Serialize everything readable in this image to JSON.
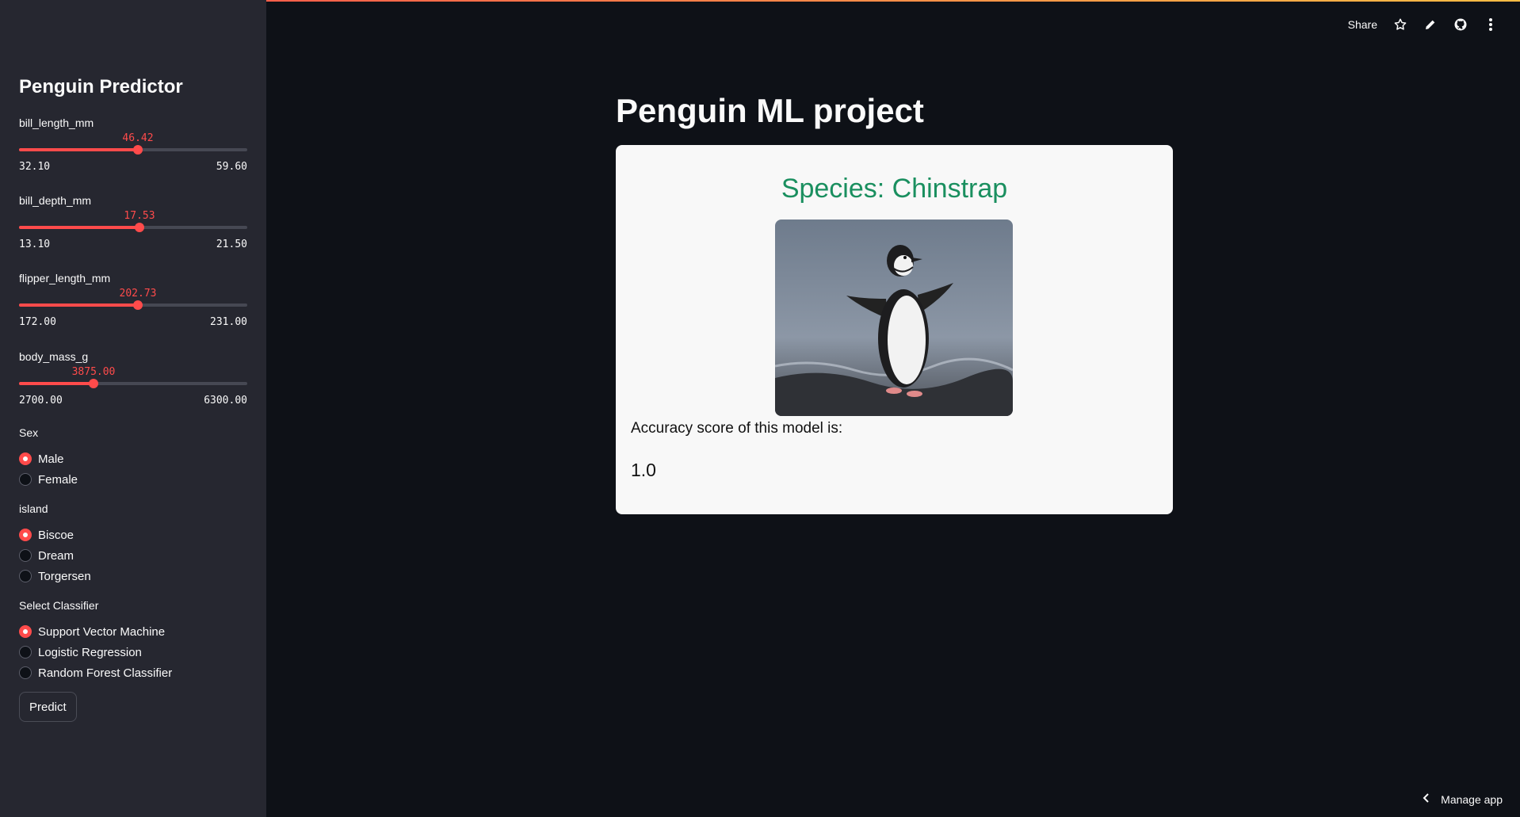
{
  "sidebar": {
    "title": "Penguin Predictor",
    "sliders": [
      {
        "label": "bill_length_mm",
        "value": "46.42",
        "min": "32.10",
        "max": "59.60",
        "fraction": 0.521
      },
      {
        "label": "bill_depth_mm",
        "value": "17.53",
        "min": "13.10",
        "max": "21.50",
        "fraction": 0.527
      },
      {
        "label": "flipper_length_mm",
        "value": "202.73",
        "min": "172.00",
        "max": "231.00",
        "fraction": 0.521
      },
      {
        "label": "body_mass_g",
        "value": "3875.00",
        "min": "2700.00",
        "max": "6300.00",
        "fraction": 0.326
      }
    ],
    "sex": {
      "label": "Sex",
      "options": [
        "Male",
        "Female"
      ],
      "selected": "Male"
    },
    "island": {
      "label": "island",
      "options": [
        "Biscoe",
        "Dream",
        "Torgersen"
      ],
      "selected": "Biscoe"
    },
    "classifier": {
      "label": "Select Classifier",
      "options": [
        "Support Vector Machine",
        "Logistic Regression",
        "Random Forest Classifier"
      ],
      "selected": "Support Vector Machine"
    },
    "predict_label": "Predict"
  },
  "header": {
    "share_label": "Share",
    "icons": [
      "star-icon",
      "pencil-icon",
      "github-icon",
      "more-vertical-icon"
    ]
  },
  "main": {
    "title": "Penguin ML project",
    "species": "Species: Chinstrap",
    "accuracy_label": "Accuracy score of this model is:",
    "accuracy_value": "1.0"
  },
  "footer": {
    "manage_app": "Manage app"
  },
  "colors": {
    "accent": "#ff4b4b",
    "species": "#1a8f5f",
    "background": "#0e1117",
    "sidebar": "#262730"
  }
}
